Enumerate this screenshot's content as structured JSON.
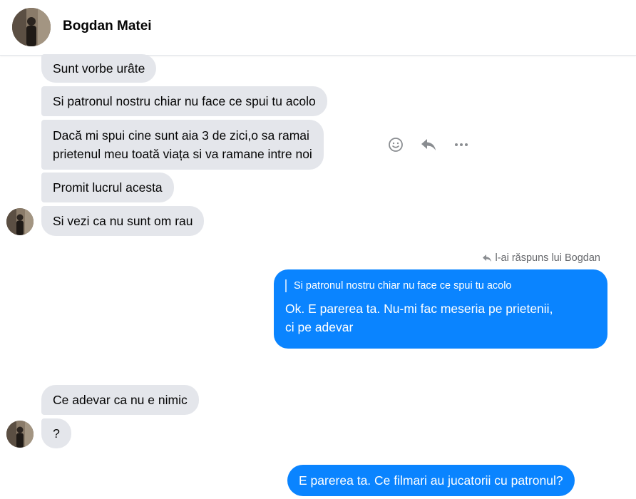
{
  "header": {
    "contact_name": "Bogdan Matei"
  },
  "messages": [
    {
      "text": "Sunt vorbe urâte"
    },
    {
      "text": "Si patronul nostru chiar nu face ce spui tu acolo"
    },
    {
      "line1": "Dacă mi spui cine sunt aia 3 de zici,o sa ramai",
      "line2": "prietenul meu toată viața si va ramane intre noi"
    },
    {
      "text": "Promit lucrul acesta"
    },
    {
      "text": "Si vezi ca nu sunt om rau"
    },
    {
      "text": "Ce adevar ca nu e nimic"
    },
    {
      "text": "?"
    }
  ],
  "reply": {
    "note": "l-ai răspuns lui Bogdan",
    "quoted": "Si patronul nostru chiar nu face ce spui tu acolo",
    "line1": "Ok. E parerea ta. Nu-mi fac meseria pe prietenii,",
    "line2": "ci pe adevar"
  },
  "outgoing_last": {
    "text": "E parerea ta. Ce filmari au jucatorii cu patronul?"
  },
  "message_actions": {
    "icons": [
      "smiley-icon",
      "reply-icon",
      "more-icon"
    ]
  },
  "colors": {
    "incoming_bubble": "#e4e6eb",
    "outgoing_bubble": "#0a84ff",
    "secondary_text": "#65676b"
  }
}
